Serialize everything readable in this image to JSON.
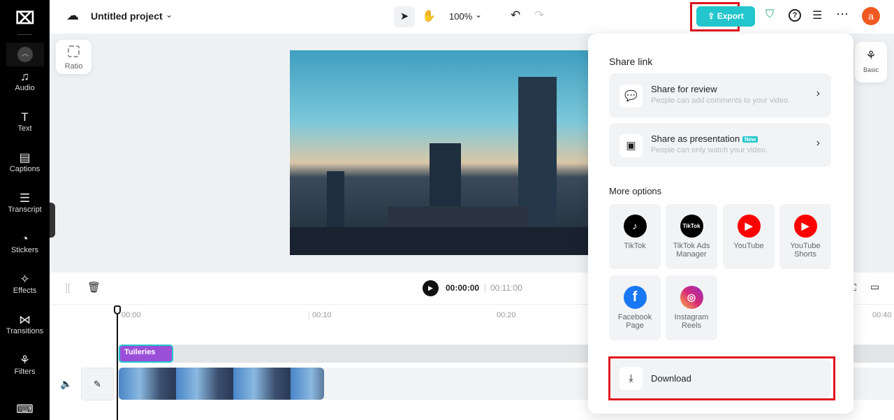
{
  "header": {
    "project_title": "Untitled project",
    "zoom": "100%",
    "export_label": "Export",
    "avatar_letter": "a"
  },
  "sidebar": {
    "items": [
      {
        "label": "Audio",
        "icon": "music-note-icon"
      },
      {
        "label": "Text",
        "icon": "text-icon"
      },
      {
        "label": "Captions",
        "icon": "captions-icon"
      },
      {
        "label": "Transcript",
        "icon": "transcript-icon"
      },
      {
        "label": "Stickers",
        "icon": "sticker-icon"
      },
      {
        "label": "Effects",
        "icon": "effects-icon"
      },
      {
        "label": "Transitions",
        "icon": "transitions-icon"
      },
      {
        "label": "Filters",
        "icon": "filters-icon"
      }
    ]
  },
  "canvas": {
    "ratio_label": "Ratio",
    "basic_label": "Basic"
  },
  "playback": {
    "current_time": "00:00:00",
    "total_time": "00:11:00"
  },
  "timeline": {
    "ticks": [
      "00:00",
      "00:10",
      "00:20",
      "00:40"
    ],
    "text_clip": "Tuileries"
  },
  "export_panel": {
    "share_heading": "Share link",
    "share_review": {
      "title": "Share for review",
      "subtitle": "People can add comments to your video."
    },
    "share_presentation": {
      "title": "Share as presentation",
      "badge": "New",
      "subtitle": "People can only watch your video."
    },
    "more_heading": "More options",
    "platforms": [
      {
        "label": "TikTok",
        "color": "#000000"
      },
      {
        "label": "TikTok Ads Manager",
        "color": "#000000"
      },
      {
        "label": "YouTube",
        "color": "#ff0000"
      },
      {
        "label": "YouTube Shorts",
        "color": "#ff0000"
      },
      {
        "label": "Facebook Page",
        "color": "#1877f2"
      },
      {
        "label": "Instagram Reels",
        "color": "#d62976"
      }
    ],
    "download_label": "Download"
  },
  "colors": {
    "accent": "#22c6cc",
    "highlight": "#e0141e",
    "avatar": "#f05a22"
  }
}
